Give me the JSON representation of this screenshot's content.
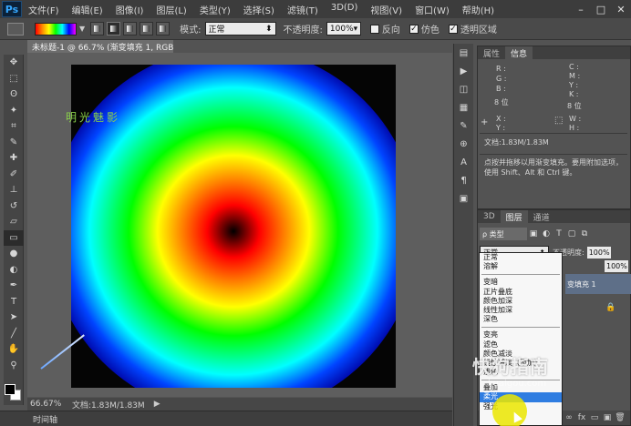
{
  "app": {
    "logo": "Ps",
    "menu": [
      "文件(F)",
      "编辑(E)",
      "图像(I)",
      "图层(L)",
      "类型(Y)",
      "选择(S)",
      "滤镜(T)",
      "3D(D)",
      "视图(V)",
      "窗口(W)",
      "帮助(H)"
    ],
    "window_controls": [
      "–",
      "□",
      "✕"
    ]
  },
  "options_bar": {
    "mode_label": "模式:",
    "mode_value": "正常",
    "opacity_label": "不透明度:",
    "opacity_value": "100%",
    "reverse_label": "反向",
    "dither_label": "仿色",
    "transparency_label": "透明区域"
  },
  "document": {
    "tab_title": "未标题-1 @ 66.7% (渐变填充 1, RGB/8) *",
    "tab_close": "×",
    "watermark_text": "明光魅影"
  },
  "status_bar": {
    "zoom": "66.67%",
    "doc_size": "文档:1.83M/1.83M",
    "arrow": "▶",
    "timeline": "时间轴"
  },
  "tools": [
    {
      "name": "move-tool-icon",
      "glyph": "✥"
    },
    {
      "name": "marquee-tool-icon",
      "glyph": "⬚"
    },
    {
      "name": "lasso-tool-icon",
      "glyph": "ʘ"
    },
    {
      "name": "magic-wand-tool-icon",
      "glyph": "✦"
    },
    {
      "name": "crop-tool-icon",
      "glyph": "⌗"
    },
    {
      "name": "eyedropper-tool-icon",
      "glyph": "✎"
    },
    {
      "name": "healing-brush-tool-icon",
      "glyph": "✚"
    },
    {
      "name": "brush-tool-icon",
      "glyph": "✐"
    },
    {
      "name": "clone-stamp-tool-icon",
      "glyph": "⊥"
    },
    {
      "name": "history-brush-tool-icon",
      "glyph": "↺"
    },
    {
      "name": "eraser-tool-icon",
      "glyph": "▱"
    },
    {
      "name": "gradient-tool-icon",
      "glyph": "▭"
    },
    {
      "name": "blur-tool-icon",
      "glyph": "●"
    },
    {
      "name": "dodge-tool-icon",
      "glyph": "◐"
    },
    {
      "name": "pen-tool-icon",
      "glyph": "✒"
    },
    {
      "name": "type-tool-icon",
      "glyph": "T"
    },
    {
      "name": "path-selection-tool-icon",
      "glyph": "➤"
    },
    {
      "name": "line-tool-icon",
      "glyph": "╱"
    },
    {
      "name": "hand-tool-icon",
      "glyph": "✋"
    },
    {
      "name": "zoom-tool-icon",
      "glyph": "⚲"
    }
  ],
  "info_panel": {
    "tabs": [
      "属性",
      "信息"
    ],
    "active_tab": 1,
    "labels": {
      "r": "R :",
      "g": "G :",
      "b": "B :",
      "c": "C :",
      "m": "M :",
      "y": "Y :",
      "k": "K :",
      "bits_left": "8 位",
      "bits_right": "8 位",
      "x": "X :",
      "y2": "Y :",
      "w": "W :",
      "h": "H :"
    },
    "doc_size": "文档:1.83M/1.83M",
    "hint": "点按并拖移以用渐变填充。要用附加选项，使用 Shift、Alt 和 Ctrl 键。"
  },
  "layers_panel": {
    "tabs": [
      "3D",
      "图层",
      "通道"
    ],
    "active_tab": 1,
    "kind_label": "ρ 类型",
    "blend_value": "正常",
    "opacity_label": "不透明度:",
    "opacity_value": "100%",
    "fill_value": "100%",
    "layer_name": "变填充 1"
  },
  "blend_modes": {
    "group1": [
      "正常",
      "溶解"
    ],
    "group2": [
      "变暗",
      "正片叠底",
      "颜色加深",
      "线性加深",
      "深色"
    ],
    "group3": [
      "变亮",
      "滤色",
      "颜色减淡",
      "线性减淡（添加）",
      "浅色"
    ],
    "group4": [
      "叠加",
      "柔光",
      "强光"
    ],
    "selected": "柔光"
  },
  "site_watermark": {
    "main": "快狗指南",
    "sub": "kuaigou.com"
  },
  "colors": {
    "foreground": "#000000",
    "background": "#ffffff",
    "selection": "#2f7de1"
  }
}
